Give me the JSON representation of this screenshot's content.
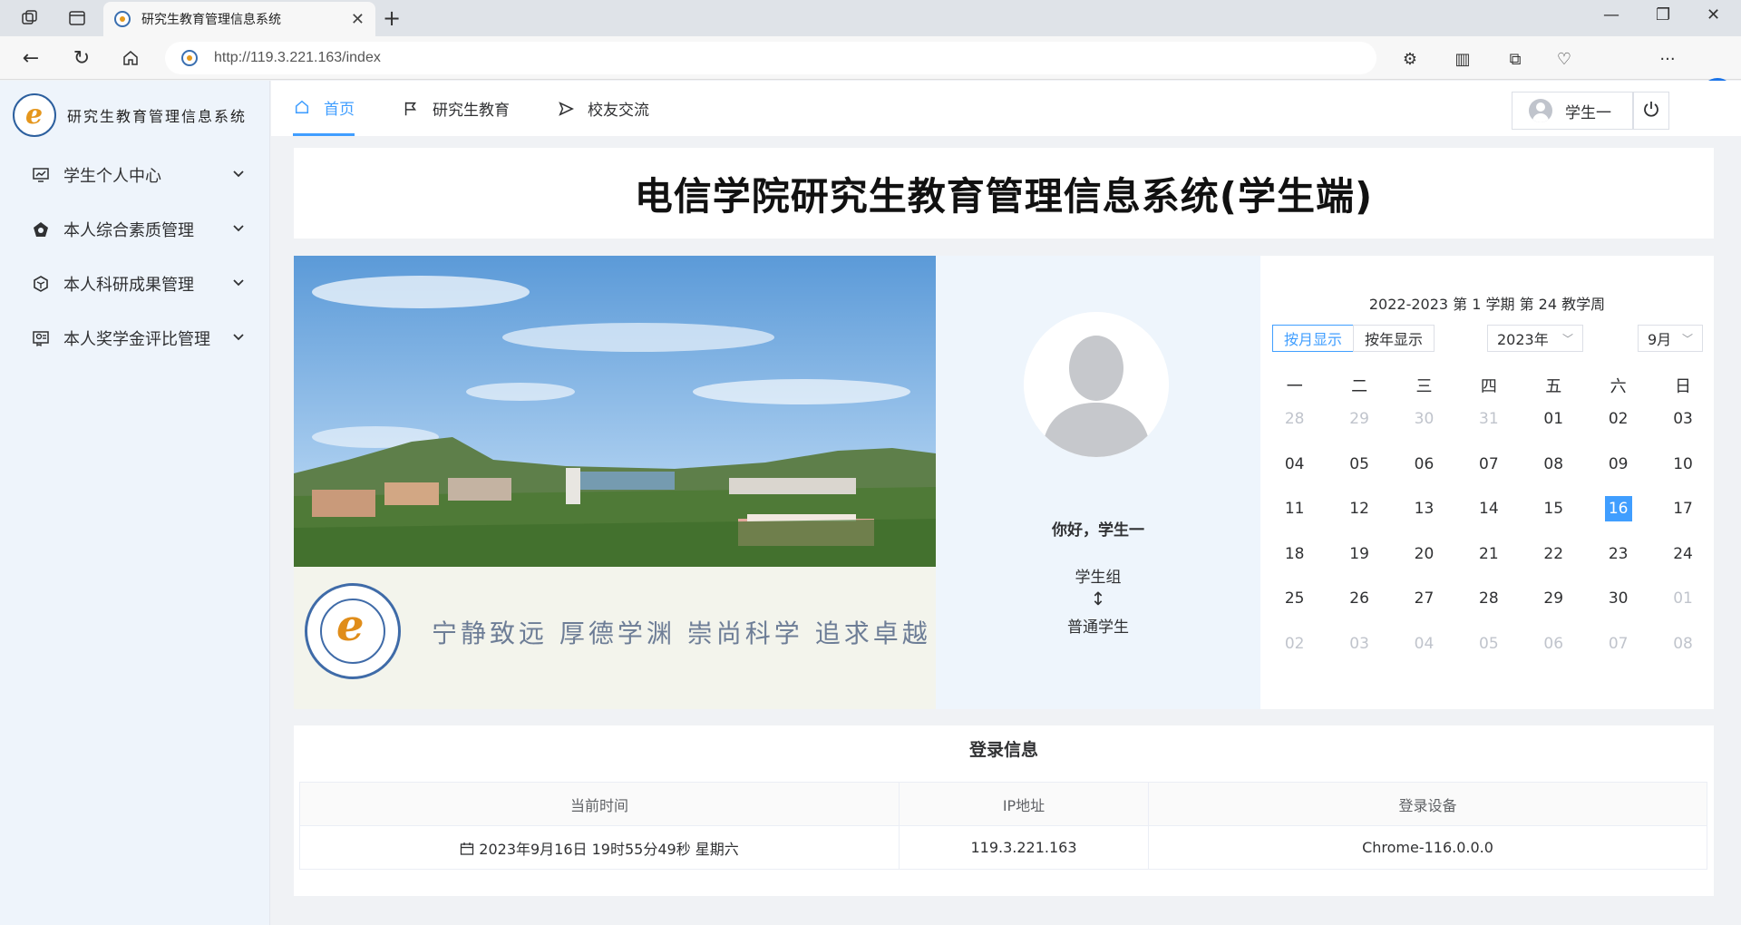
{
  "browser": {
    "tab_title": "研究生教育管理信息系统",
    "url": "http://119.3.221.163/index"
  },
  "sidebar": {
    "brand": "研究生教育管理信息系统",
    "items": [
      {
        "label": "学生个人中心",
        "icon": "chart-monitor-icon"
      },
      {
        "label": "本人综合素质管理",
        "icon": "home-pentagon-icon"
      },
      {
        "label": "本人科研成果管理",
        "icon": "cube-icon"
      },
      {
        "label": "本人奖学金评比管理",
        "icon": "certificate-icon"
      }
    ]
  },
  "topnav": {
    "tabs": [
      {
        "label": "首页",
        "icon": "home-icon",
        "active": true
      },
      {
        "label": "研究生教育",
        "icon": "flag-icon",
        "active": false
      },
      {
        "label": "校友交流",
        "icon": "send-icon",
        "active": false
      }
    ],
    "user": "学生一"
  },
  "title": "电信学院研究生教育管理信息系统(学生端)",
  "banner": {
    "motto": "宁静致远 厚德学渊 崇尚科学 追求卓越"
  },
  "profile": {
    "greeting": "你好，学生一",
    "group": "学生组",
    "arrow": "↕",
    "role": "普通学生"
  },
  "calendar": {
    "header": "2022-2023 第 1 学期 第 24 教学周",
    "view_month": "按月显示",
    "view_year": "按年显示",
    "year": "2023年",
    "month": "9月",
    "weekdays": [
      "一",
      "二",
      "三",
      "四",
      "五",
      "六",
      "日"
    ],
    "today": "16",
    "days": [
      {
        "d": "28",
        "other": true
      },
      {
        "d": "29",
        "other": true
      },
      {
        "d": "30",
        "other": true
      },
      {
        "d": "31",
        "other": true
      },
      {
        "d": "01"
      },
      {
        "d": "02"
      },
      {
        "d": "03"
      },
      {
        "d": "04"
      },
      {
        "d": "05"
      },
      {
        "d": "06"
      },
      {
        "d": "07"
      },
      {
        "d": "08"
      },
      {
        "d": "09"
      },
      {
        "d": "10"
      },
      {
        "d": "11"
      },
      {
        "d": "12"
      },
      {
        "d": "13"
      },
      {
        "d": "14"
      },
      {
        "d": "15"
      },
      {
        "d": "16"
      },
      {
        "d": "17"
      },
      {
        "d": "18"
      },
      {
        "d": "19"
      },
      {
        "d": "20"
      },
      {
        "d": "21"
      },
      {
        "d": "22"
      },
      {
        "d": "23"
      },
      {
        "d": "24"
      },
      {
        "d": "25"
      },
      {
        "d": "26"
      },
      {
        "d": "27"
      },
      {
        "d": "28"
      },
      {
        "d": "29"
      },
      {
        "d": "30"
      },
      {
        "d": "01",
        "other": true
      },
      {
        "d": "02",
        "other": true
      },
      {
        "d": "03",
        "other": true
      },
      {
        "d": "04",
        "other": true
      },
      {
        "d": "05",
        "other": true
      },
      {
        "d": "06",
        "other": true
      },
      {
        "d": "07",
        "other": true
      },
      {
        "d": "08",
        "other": true
      }
    ]
  },
  "login_info": {
    "title": "登录信息",
    "headers": [
      "当前时间",
      "IP地址",
      "登录设备"
    ],
    "time": "2023年9月16日 19时55分49秒 星期六",
    "ip": "119.3.221.163",
    "device": "Chrome-116.0.0.0"
  },
  "colors": {
    "accent": "#409eff",
    "sidebar_bg": "#eef4fb"
  }
}
